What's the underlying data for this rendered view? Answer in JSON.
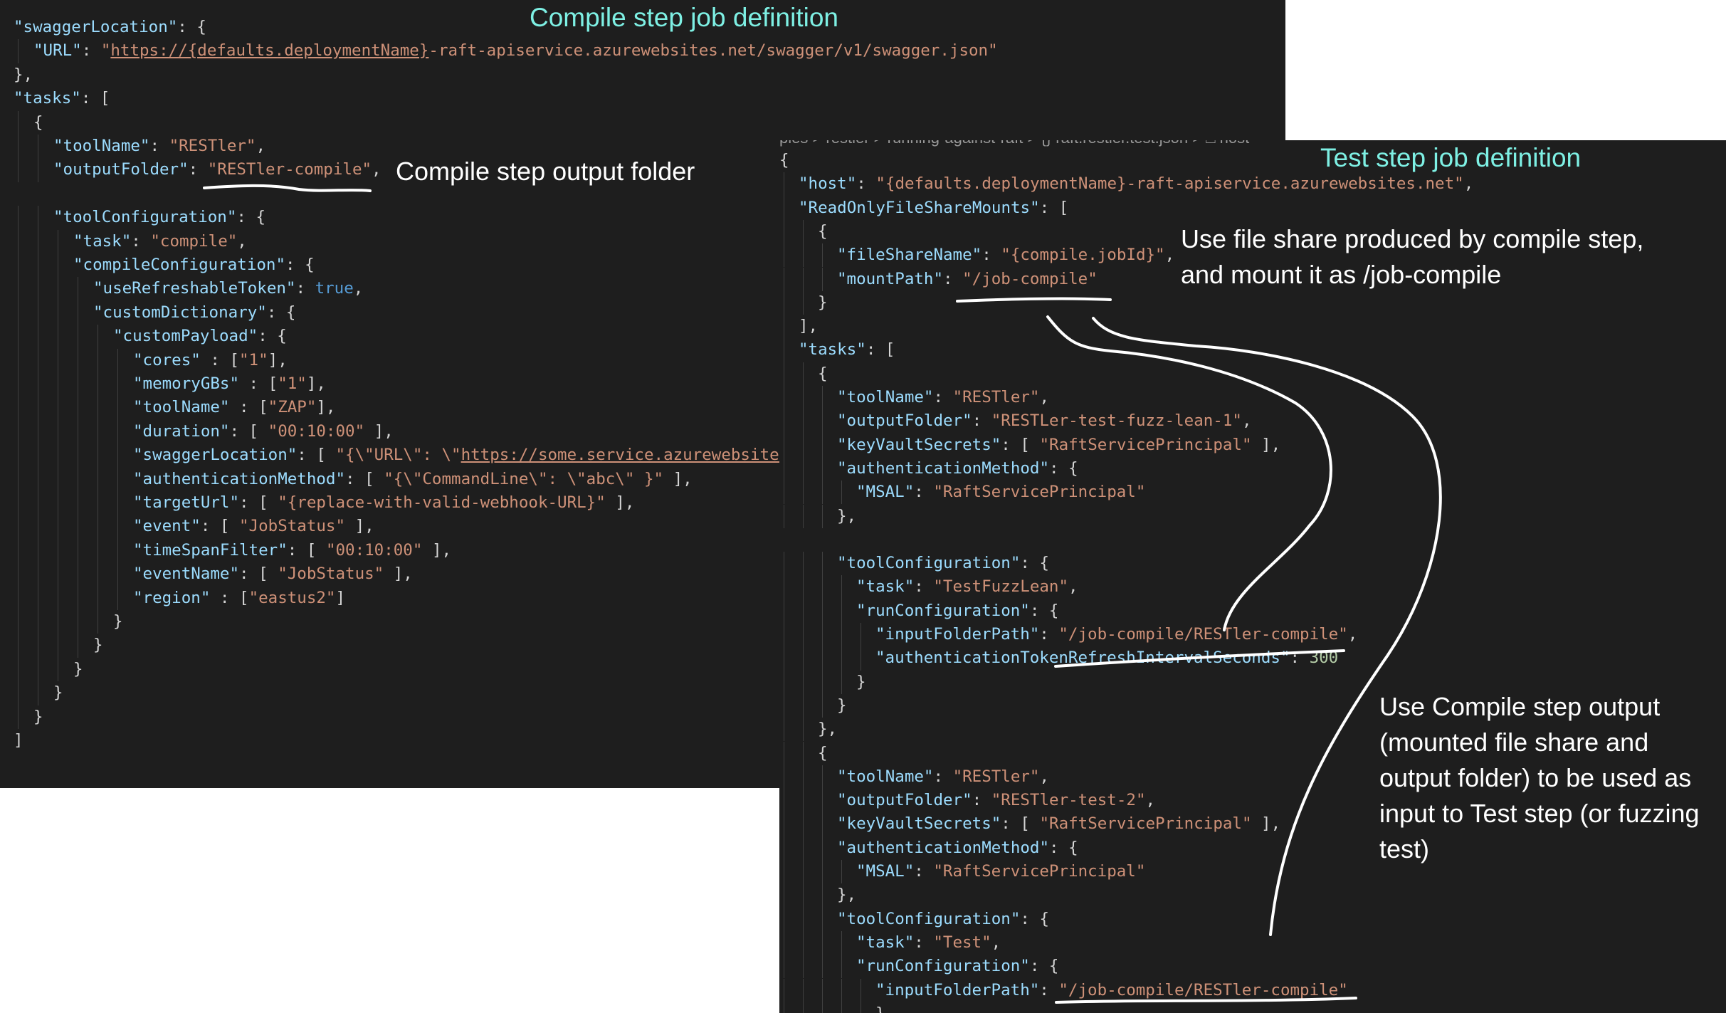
{
  "titles": {
    "compile": "Compile step job definition",
    "test": "Test step job definition"
  },
  "notes": {
    "output_folder": "Compile step output folder",
    "file_share": [
      "Use file share produced by compile step,",
      "and mount it as /job-compile"
    ],
    "use_output": [
      "Use Compile step output",
      "(mounted file share and",
      "output folder) to be used as",
      "input to Test step (or fuzzing",
      "test)"
    ]
  },
  "breadcrumb": "ples > restler > running-against-raft > {} raft.restler.test.json > □ host",
  "compile_json": [
    {
      "indent": 0,
      "tokens": [
        [
          "k",
          "\"swaggerLocation\""
        ],
        [
          "p",
          ": {"
        ]
      ]
    },
    {
      "indent": 1,
      "tokens": [
        [
          "k",
          "\"URL\""
        ],
        [
          "p",
          ": "
        ],
        [
          "s",
          "\""
        ],
        [
          "su",
          "https://{defaults.deploymentName}"
        ],
        [
          "s",
          "-raft-apiservice.azurewebsites.net/swagger/v1/swagger.json\""
        ]
      ]
    },
    {
      "indent": 0,
      "tokens": [
        [
          "p",
          "},"
        ]
      ]
    },
    {
      "indent": 0,
      "tokens": [
        [
          "k",
          "\"tasks\""
        ],
        [
          "p",
          ": ["
        ]
      ]
    },
    {
      "indent": 1,
      "tokens": [
        [
          "p",
          "{"
        ]
      ]
    },
    {
      "indent": 2,
      "tokens": [
        [
          "k",
          "\"toolName\""
        ],
        [
          "p",
          ": "
        ],
        [
          "s",
          "\"RESTler\""
        ],
        [
          "p",
          ","
        ]
      ]
    },
    {
      "indent": 2,
      "tokens": [
        [
          "k",
          "\"outputFolder\""
        ],
        [
          "p",
          ": "
        ],
        [
          "s",
          "\"RESTler-compile\""
        ],
        [
          "p",
          ","
        ]
      ]
    },
    {
      "indent": 0,
      "tokens": []
    },
    {
      "indent": 2,
      "tokens": [
        [
          "k",
          "\"toolConfiguration\""
        ],
        [
          "p",
          ": {"
        ]
      ]
    },
    {
      "indent": 3,
      "tokens": [
        [
          "k",
          "\"task\""
        ],
        [
          "p",
          ": "
        ],
        [
          "s",
          "\"compile\""
        ],
        [
          "p",
          ","
        ]
      ]
    },
    {
      "indent": 3,
      "tokens": [
        [
          "k",
          "\"compileConfiguration\""
        ],
        [
          "p",
          ": {"
        ]
      ]
    },
    {
      "indent": 4,
      "tokens": [
        [
          "k",
          "\"useRefreshableToken\""
        ],
        [
          "p",
          ": "
        ],
        [
          "b",
          "true"
        ],
        [
          "p",
          ","
        ]
      ]
    },
    {
      "indent": 4,
      "tokens": [
        [
          "k",
          "\"customDictionary\""
        ],
        [
          "p",
          ": {"
        ]
      ]
    },
    {
      "indent": 5,
      "tokens": [
        [
          "k",
          "\"customPayload\""
        ],
        [
          "p",
          ": {"
        ]
      ]
    },
    {
      "indent": 6,
      "tokens": [
        [
          "k",
          "\"cores\""
        ],
        [
          "p",
          " : ["
        ],
        [
          "s",
          "\"1\""
        ],
        [
          "p",
          "],"
        ]
      ]
    },
    {
      "indent": 6,
      "tokens": [
        [
          "k",
          "\"memoryGBs\""
        ],
        [
          "p",
          " : ["
        ],
        [
          "s",
          "\"1\""
        ],
        [
          "p",
          "],"
        ]
      ]
    },
    {
      "indent": 6,
      "tokens": [
        [
          "k",
          "\"toolName\""
        ],
        [
          "p",
          " : ["
        ],
        [
          "s",
          "\"ZAP\""
        ],
        [
          "p",
          "],"
        ]
      ]
    },
    {
      "indent": 6,
      "tokens": [
        [
          "k",
          "\"duration\""
        ],
        [
          "p",
          ": [ "
        ],
        [
          "s",
          "\"00:10:00\""
        ],
        [
          "p",
          " ],"
        ]
      ]
    },
    {
      "indent": 6,
      "tokens": [
        [
          "k",
          "\"swaggerLocation\""
        ],
        [
          "p",
          ": [ "
        ],
        [
          "s",
          "\"{\\\"URL\\\": \\\""
        ],
        [
          "su",
          "https://some.service.azurewebsites"
        ]
      ]
    },
    {
      "indent": 6,
      "tokens": [
        [
          "k",
          "\"authenticationMethod\""
        ],
        [
          "p",
          ": [ "
        ],
        [
          "s",
          "\"{\\\"CommandLine\\\": \\\"abc\\\" }\""
        ],
        [
          "p",
          " ],"
        ]
      ]
    },
    {
      "indent": 6,
      "tokens": [
        [
          "k",
          "\"targetUrl\""
        ],
        [
          "p",
          ": [ "
        ],
        [
          "s",
          "\"{replace-with-valid-webhook-URL}\""
        ],
        [
          "p",
          " ],"
        ]
      ]
    },
    {
      "indent": 6,
      "tokens": [
        [
          "k",
          "\"event\""
        ],
        [
          "p",
          ": [ "
        ],
        [
          "s",
          "\"JobStatus\""
        ],
        [
          "p",
          " ],"
        ]
      ]
    },
    {
      "indent": 6,
      "tokens": [
        [
          "k",
          "\"timeSpanFilter\""
        ],
        [
          "p",
          ": [ "
        ],
        [
          "s",
          "\"00:10:00\""
        ],
        [
          "p",
          " ],"
        ]
      ]
    },
    {
      "indent": 6,
      "tokens": [
        [
          "k",
          "\"eventName\""
        ],
        [
          "p",
          ": [ "
        ],
        [
          "s",
          "\"JobStatus\""
        ],
        [
          "p",
          " ],"
        ]
      ]
    },
    {
      "indent": 6,
      "tokens": [
        [
          "k",
          "\"region\""
        ],
        [
          "p",
          " : ["
        ],
        [
          "s",
          "\"eastus2\""
        ],
        [
          "p",
          "]"
        ]
      ]
    },
    {
      "indent": 5,
      "tokens": [
        [
          "p",
          "}"
        ]
      ]
    },
    {
      "indent": 4,
      "tokens": [
        [
          "p",
          "}"
        ]
      ]
    },
    {
      "indent": 3,
      "tokens": [
        [
          "p",
          "}"
        ]
      ]
    },
    {
      "indent": 2,
      "tokens": [
        [
          "p",
          "}"
        ]
      ]
    },
    {
      "indent": 1,
      "tokens": [
        [
          "p",
          "}"
        ]
      ]
    },
    {
      "indent": 0,
      "tokens": [
        [
          "p",
          "]"
        ]
      ]
    }
  ],
  "test_json": [
    {
      "indent": 0,
      "tokens": [
        [
          "p",
          "{"
        ]
      ]
    },
    {
      "indent": 1,
      "tokens": [
        [
          "k",
          "\"host\""
        ],
        [
          "p",
          ": "
        ],
        [
          "s",
          "\"{defaults.deploymentName}-raft-apiservice.azurewebsites.net\""
        ],
        [
          "p",
          ","
        ]
      ]
    },
    {
      "indent": 1,
      "tokens": [
        [
          "k",
          "\"ReadOnlyFileShareMounts\""
        ],
        [
          "p",
          ": ["
        ]
      ]
    },
    {
      "indent": 2,
      "tokens": [
        [
          "p",
          "{"
        ]
      ]
    },
    {
      "indent": 3,
      "tokens": [
        [
          "k",
          "\"fileShareName\""
        ],
        [
          "p",
          ": "
        ],
        [
          "s",
          "\"{compile.jobId}\""
        ],
        [
          "p",
          ","
        ]
      ]
    },
    {
      "indent": 3,
      "tokens": [
        [
          "k",
          "\"mountPath\""
        ],
        [
          "p",
          ": "
        ],
        [
          "s",
          "\"/job-compile\""
        ]
      ]
    },
    {
      "indent": 2,
      "tokens": [
        [
          "p",
          "}"
        ]
      ]
    },
    {
      "indent": 1,
      "tokens": [
        [
          "p",
          "],"
        ]
      ]
    },
    {
      "indent": 1,
      "tokens": [
        [
          "k",
          "\"tasks\""
        ],
        [
          "p",
          ": ["
        ]
      ]
    },
    {
      "indent": 2,
      "tokens": [
        [
          "p",
          "{"
        ]
      ]
    },
    {
      "indent": 3,
      "tokens": [
        [
          "k",
          "\"toolName\""
        ],
        [
          "p",
          ": "
        ],
        [
          "s",
          "\"RESTler\""
        ],
        [
          "p",
          ","
        ]
      ]
    },
    {
      "indent": 3,
      "tokens": [
        [
          "k",
          "\"outputFolder\""
        ],
        [
          "p",
          ": "
        ],
        [
          "s",
          "\"RESTLer-test-fuzz-lean-1\""
        ],
        [
          "p",
          ","
        ]
      ]
    },
    {
      "indent": 3,
      "tokens": [
        [
          "k",
          "\"keyVaultSecrets\""
        ],
        [
          "p",
          ": [ "
        ],
        [
          "s",
          "\"RaftServicePrincipal\""
        ],
        [
          "p",
          " ],"
        ]
      ]
    },
    {
      "indent": 3,
      "tokens": [
        [
          "k",
          "\"authenticationMethod\""
        ],
        [
          "p",
          ": {"
        ]
      ]
    },
    {
      "indent": 4,
      "tokens": [
        [
          "k",
          "\"MSAL\""
        ],
        [
          "p",
          ": "
        ],
        [
          "s",
          "\"RaftServicePrincipal\""
        ]
      ]
    },
    {
      "indent": 3,
      "tokens": [
        [
          "p",
          "},"
        ]
      ]
    },
    {
      "indent": 0,
      "tokens": []
    },
    {
      "indent": 3,
      "tokens": [
        [
          "k",
          "\"toolConfiguration\""
        ],
        [
          "p",
          ": {"
        ]
      ]
    },
    {
      "indent": 4,
      "tokens": [
        [
          "k",
          "\"task\""
        ],
        [
          "p",
          ": "
        ],
        [
          "s",
          "\"TestFuzzLean\""
        ],
        [
          "p",
          ","
        ]
      ]
    },
    {
      "indent": 4,
      "tokens": [
        [
          "k",
          "\"runConfiguration\""
        ],
        [
          "p",
          ": {"
        ]
      ]
    },
    {
      "indent": 5,
      "tokens": [
        [
          "k",
          "\"inputFolderPath\""
        ],
        [
          "p",
          ": "
        ],
        [
          "s",
          "\"/job-compile/RESTler-compile\""
        ],
        [
          "p",
          ","
        ]
      ]
    },
    {
      "indent": 5,
      "tokens": [
        [
          "k",
          "\"authenticationTokenRefreshIntervalSeconds\""
        ],
        [
          "p",
          ": "
        ],
        [
          "n",
          "300"
        ]
      ]
    },
    {
      "indent": 4,
      "tokens": [
        [
          "p",
          "}"
        ]
      ]
    },
    {
      "indent": 3,
      "tokens": [
        [
          "p",
          "}"
        ]
      ]
    },
    {
      "indent": 2,
      "tokens": [
        [
          "p",
          "},"
        ]
      ]
    },
    {
      "indent": 2,
      "tokens": [
        [
          "p",
          "{"
        ]
      ]
    },
    {
      "indent": 3,
      "tokens": [
        [
          "k",
          "\"toolName\""
        ],
        [
          "p",
          ": "
        ],
        [
          "s",
          "\"RESTler\""
        ],
        [
          "p",
          ","
        ]
      ]
    },
    {
      "indent": 3,
      "tokens": [
        [
          "k",
          "\"outputFolder\""
        ],
        [
          "p",
          ": "
        ],
        [
          "s",
          "\"RESTler-test-2\""
        ],
        [
          "p",
          ","
        ]
      ]
    },
    {
      "indent": 3,
      "tokens": [
        [
          "k",
          "\"keyVaultSecrets\""
        ],
        [
          "p",
          ": [ "
        ],
        [
          "s",
          "\"RaftServicePrincipal\""
        ],
        [
          "p",
          " ],"
        ]
      ]
    },
    {
      "indent": 3,
      "tokens": [
        [
          "k",
          "\"authenticationMethod\""
        ],
        [
          "p",
          ": {"
        ]
      ]
    },
    {
      "indent": 4,
      "tokens": [
        [
          "k",
          "\"MSAL\""
        ],
        [
          "p",
          ": "
        ],
        [
          "s",
          "\"RaftServicePrincipal\""
        ]
      ]
    },
    {
      "indent": 3,
      "tokens": [
        [
          "p",
          "},"
        ]
      ]
    },
    {
      "indent": 3,
      "tokens": [
        [
          "k",
          "\"toolConfiguration\""
        ],
        [
          "p",
          ": {"
        ]
      ]
    },
    {
      "indent": 4,
      "tokens": [
        [
          "k",
          "\"task\""
        ],
        [
          "p",
          ": "
        ],
        [
          "s",
          "\"Test\""
        ],
        [
          "p",
          ","
        ]
      ]
    },
    {
      "indent": 4,
      "tokens": [
        [
          "k",
          "\"runConfiguration\""
        ],
        [
          "p",
          ": {"
        ]
      ]
    },
    {
      "indent": 5,
      "tokens": [
        [
          "k",
          "\"inputFolderPath\""
        ],
        [
          "p",
          ": "
        ],
        [
          "s",
          "\"/job-compile/RESTler-compile\""
        ]
      ]
    },
    {
      "indent": 5,
      "tokens": [
        [
          "p",
          "}"
        ]
      ]
    }
  ]
}
